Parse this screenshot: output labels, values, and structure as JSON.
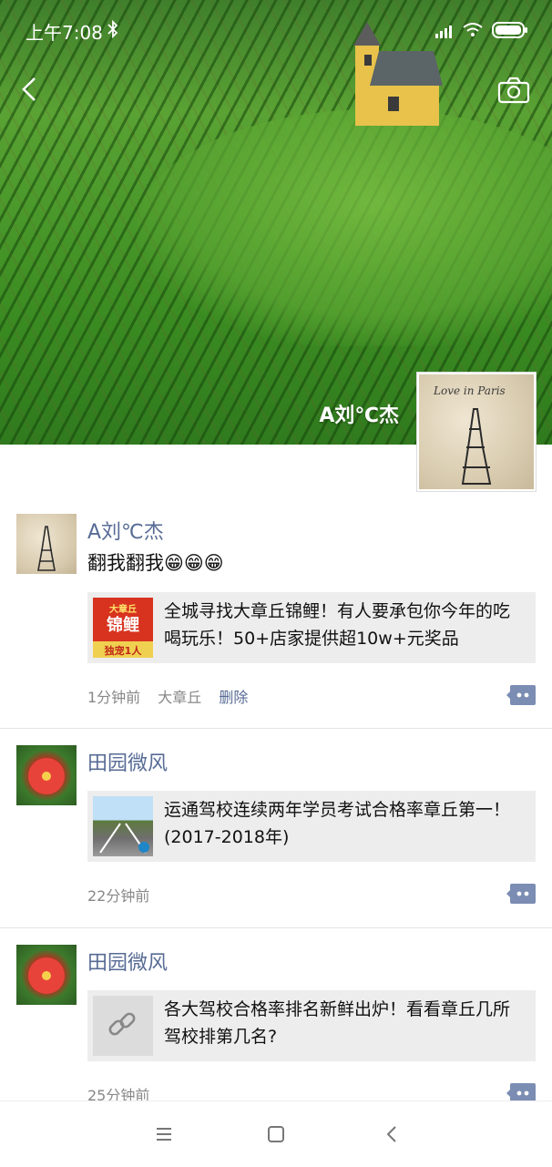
{
  "status_bar": {
    "time": "上午7:08",
    "icons": [
      "bluetooth-icon",
      "signal-icon",
      "wifi-icon",
      "battery-icon"
    ]
  },
  "header": {
    "back_icon": "back-arrow-icon",
    "camera_icon": "camera-icon"
  },
  "profile": {
    "name": "A刘℃杰",
    "avatar_caption": "Love in Paris"
  },
  "posts": [
    {
      "author": "A刘℃杰",
      "text": "翻我翻我😁😁😁",
      "link_title": "全城寻找大章丘锦鲤！有人要承包你今年的吃喝玩乐！50+店家提供超10w+元奖品",
      "thumb_text_top": "大章丘",
      "thumb_text_main": "锦鲤",
      "thumb_text_bottom": "独宠1人",
      "time": "1分钟前",
      "location": "大章丘",
      "delete_label": "删除"
    },
    {
      "author": "田园微风",
      "link_title": "运通驾校连续两年学员考试合格率章丘第一！(2017-2018年)",
      "time": "22分钟前"
    },
    {
      "author": "田园微风",
      "link_title": "各大驾校合格率排名新鲜出炉！看看章丘几所驾校排第几名?",
      "time": "25分钟前"
    }
  ],
  "colors": {
    "name_blue": "#576b95",
    "meta_gray": "#888888",
    "card_bg": "#ededed"
  },
  "nav": {
    "icons": [
      "menu-icon",
      "home-icon",
      "back-icon"
    ]
  }
}
